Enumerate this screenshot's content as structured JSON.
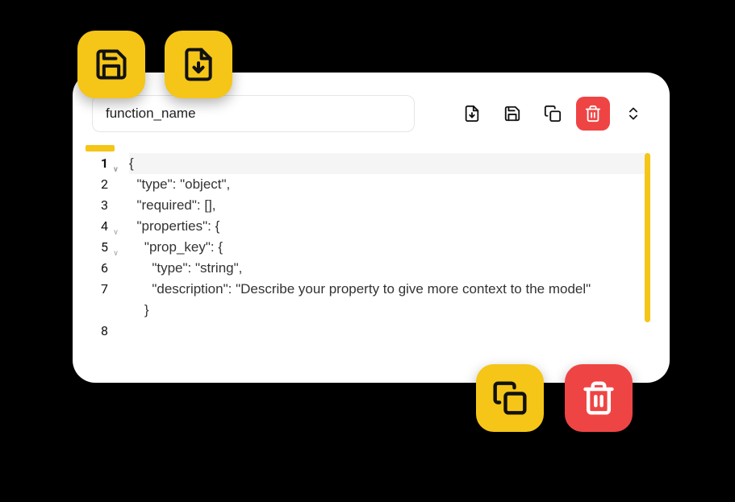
{
  "input": {
    "value": "function_name"
  },
  "code": {
    "lines": [
      "{",
      "  \"type\": \"object\",",
      "  \"required\": [],",
      "  \"properties\": {",
      "    \"prop_key\": {",
      "      \"type\": \"string\",",
      "      \"description\": \"Describe your property to give more context to the model\"",
      "    }"
    ],
    "lineNumbers": [
      "1",
      "2",
      "3",
      "4",
      "5",
      "6",
      "7",
      "8"
    ]
  },
  "colors": {
    "accent": "#f5c518",
    "danger": "#ef4444"
  }
}
